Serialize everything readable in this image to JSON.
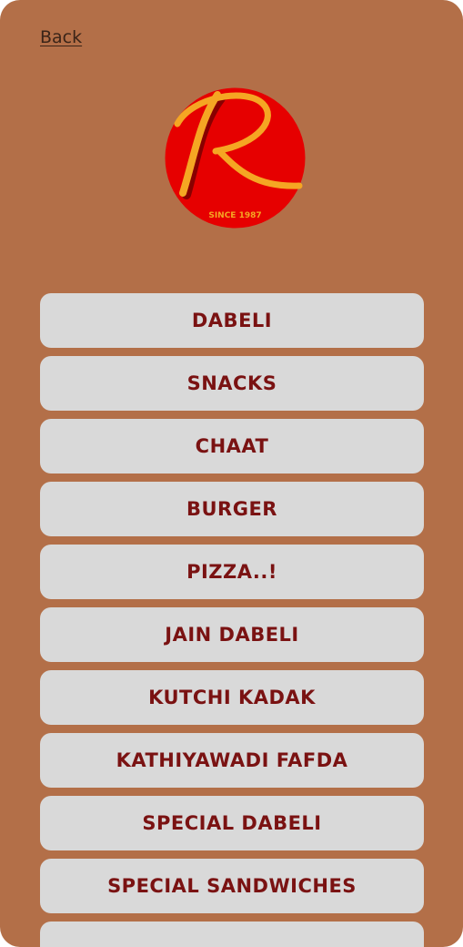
{
  "nav": {
    "back_label": "Back"
  },
  "logo": {
    "letter": "R",
    "tagline": "SINCE 1987",
    "circle_color": "#e60000",
    "letter_color": "#f5a623"
  },
  "menu": {
    "items": [
      {
        "label": "DABELI"
      },
      {
        "label": "SNACKS"
      },
      {
        "label": "CHAAT"
      },
      {
        "label": "BURGER"
      },
      {
        "label": "PIZZA..!"
      },
      {
        "label": "JAIN DABELI"
      },
      {
        "label": "KUTCHI KADAK"
      },
      {
        "label": "KATHIYAWADI FAFDA"
      },
      {
        "label": "SPECIAL DABELI"
      },
      {
        "label": "SPECIAL SANDWICHES"
      },
      {
        "label": ""
      }
    ]
  },
  "colors": {
    "background": "#b36f48",
    "button_bg": "#d9d9d9",
    "button_text": "#7a1212"
  }
}
